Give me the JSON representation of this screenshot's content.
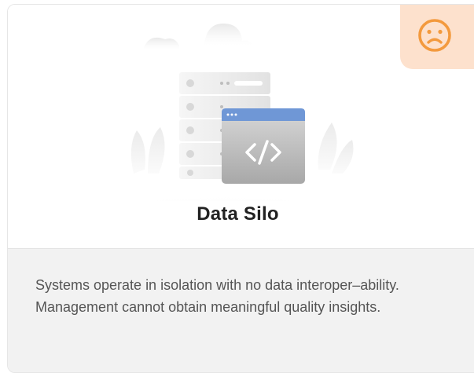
{
  "card": {
    "title": "Data Silo",
    "description": "Systems operate in isolation with no data interoper–ability. Management cannot obtain meaningful quality insights.",
    "status_icon": "sad-face-icon",
    "colors": {
      "badge_background": "#fde1cd",
      "badge_icon": "#f39a3e",
      "window_header": "#6f97d6",
      "description_background": "#f2f2f2"
    }
  }
}
